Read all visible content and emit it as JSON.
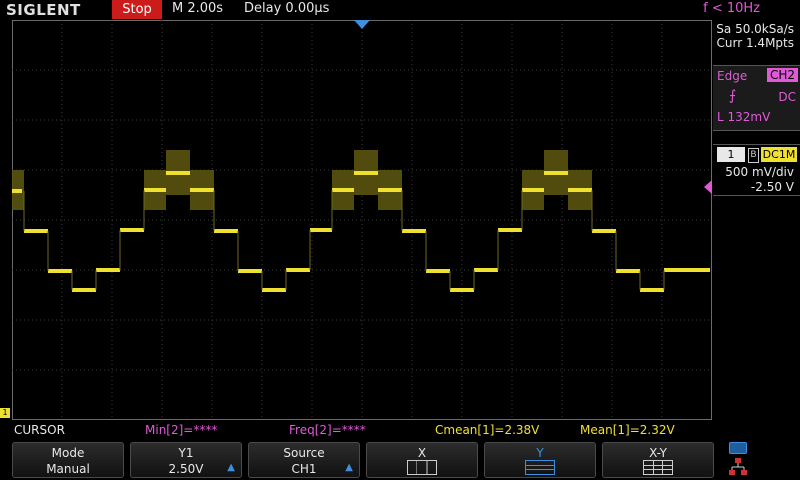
{
  "status": {
    "brand": "SIGLENT",
    "run_state": "Stop",
    "timebase": "M 2.00s",
    "delay": "Delay 0.00µs",
    "trigger_freq": "f < 10Hz"
  },
  "acquisition": {
    "sample_rate": "Sa 50.0kSa/s",
    "memory": "Curr 1.4Mpts"
  },
  "trigger": {
    "type": "Edge",
    "source": "CH2",
    "slope_icon": "rising-edge-icon",
    "coupling": "DC",
    "level": "L   132mV",
    "color": "#e05ad8"
  },
  "channel1": {
    "number": "1",
    "bandwidth_icon": "B",
    "coupling": "DC1M",
    "vdiv": "500 mV/div",
    "offset": "-2.50 V",
    "ground_marker": "1",
    "color": "#f0e030"
  },
  "measurements": {
    "mode": "CURSOR",
    "min": "Min[2]=****",
    "freq": "Freq[2]=****",
    "cmean": "Cmean[1]=2.38V",
    "mean": "Mean[1]=2.32V"
  },
  "softkeys": [
    {
      "line1": "Mode",
      "line2": "Manual"
    },
    {
      "line1": "Y1",
      "line2": "2.50V"
    },
    {
      "line1": "Source",
      "line2": "CH1"
    },
    {
      "line1": "X",
      "line2": ""
    },
    {
      "line1": "Y",
      "line2": ""
    },
    {
      "line1": "X-Y",
      "line2": ""
    }
  ],
  "icons": {
    "usb": "usb-icon",
    "network": "network-icon"
  }
}
